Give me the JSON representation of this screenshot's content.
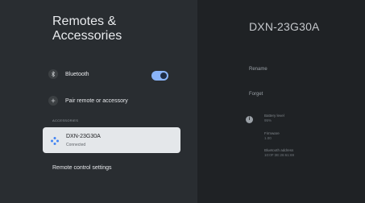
{
  "page": {
    "title": "Remotes &\nAccessories"
  },
  "settings": {
    "bluetooth_label": "Bluetooth",
    "bluetooth_on": true,
    "pair_label": "Pair remote or accessory",
    "section_header": "ACCESSORIES",
    "device": {
      "name": "DXN-23G30A",
      "status": "Connected"
    },
    "remote_settings_label": "Remote control settings"
  },
  "detail": {
    "device_title": "DXN-23G30A",
    "rename_label": "Rename",
    "forget_label": "Forget",
    "battery_label": "Battery level",
    "battery_value": "95%",
    "firmware_label": "Firmware",
    "firmware_value": "1.00",
    "address_label": "Bluetooth address",
    "address_value": "10:0F:3E:26:61:69"
  },
  "colors": {
    "accent": "#8ab4f8",
    "card": "#e4e7ea",
    "left_panel": "#292d31",
    "right_panel": "#1f2225"
  }
}
